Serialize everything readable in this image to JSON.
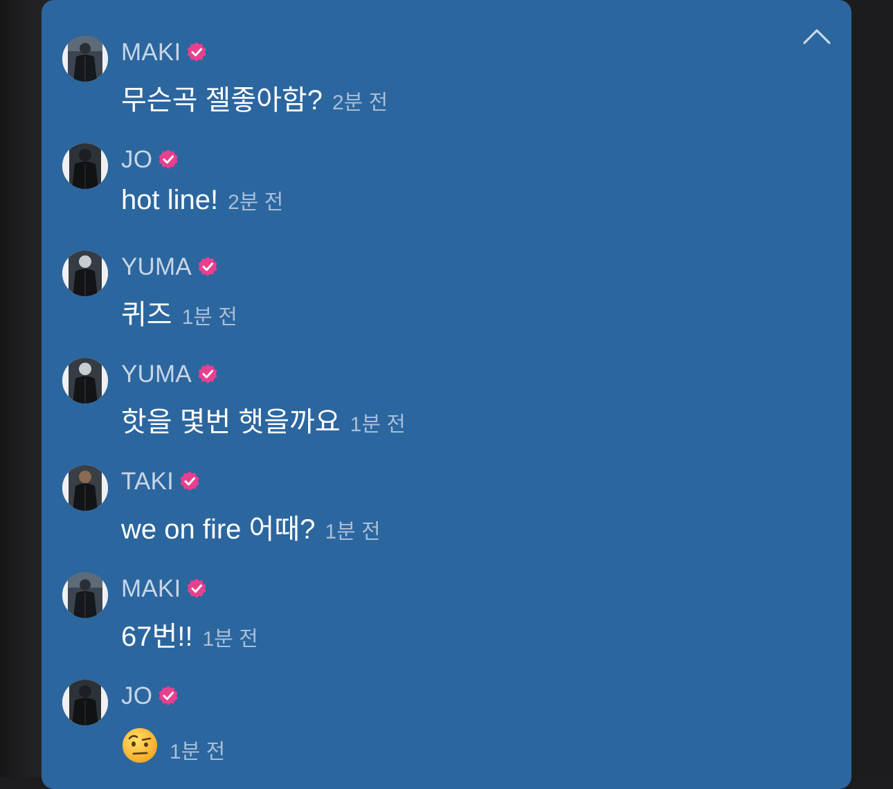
{
  "colors": {
    "panel": "#2c669f",
    "username": "#c6d6e8",
    "message": "#ffffff",
    "time": "#a9bfd8",
    "verified_badge": "#e8408f"
  },
  "header": {
    "collapse_icon": "chevron-up-icon"
  },
  "messages": [
    {
      "user": "MAKI",
      "text": "무슨곡 젤좋아함?",
      "time": "2분 전",
      "verified": true
    },
    {
      "user": "JO",
      "text": "hot line!",
      "time": "2분 전",
      "verified": true
    },
    {
      "user": "YUMA",
      "text": "퀴즈",
      "time": "1분 전",
      "verified": true
    },
    {
      "user": "YUMA",
      "text": "핫을 몇번 햇을까요",
      "time": "1분 전",
      "verified": true
    },
    {
      "user": "TAKI",
      "text": "we on fire 어때?",
      "time": "1분 전",
      "verified": true
    },
    {
      "user": "MAKI",
      "text": "67번!!",
      "time": "1분 전",
      "verified": true
    },
    {
      "user": "JO",
      "text": "",
      "emoji": "face-with-raised-eyebrow-emoji",
      "time": "1분 전",
      "verified": true
    }
  ]
}
